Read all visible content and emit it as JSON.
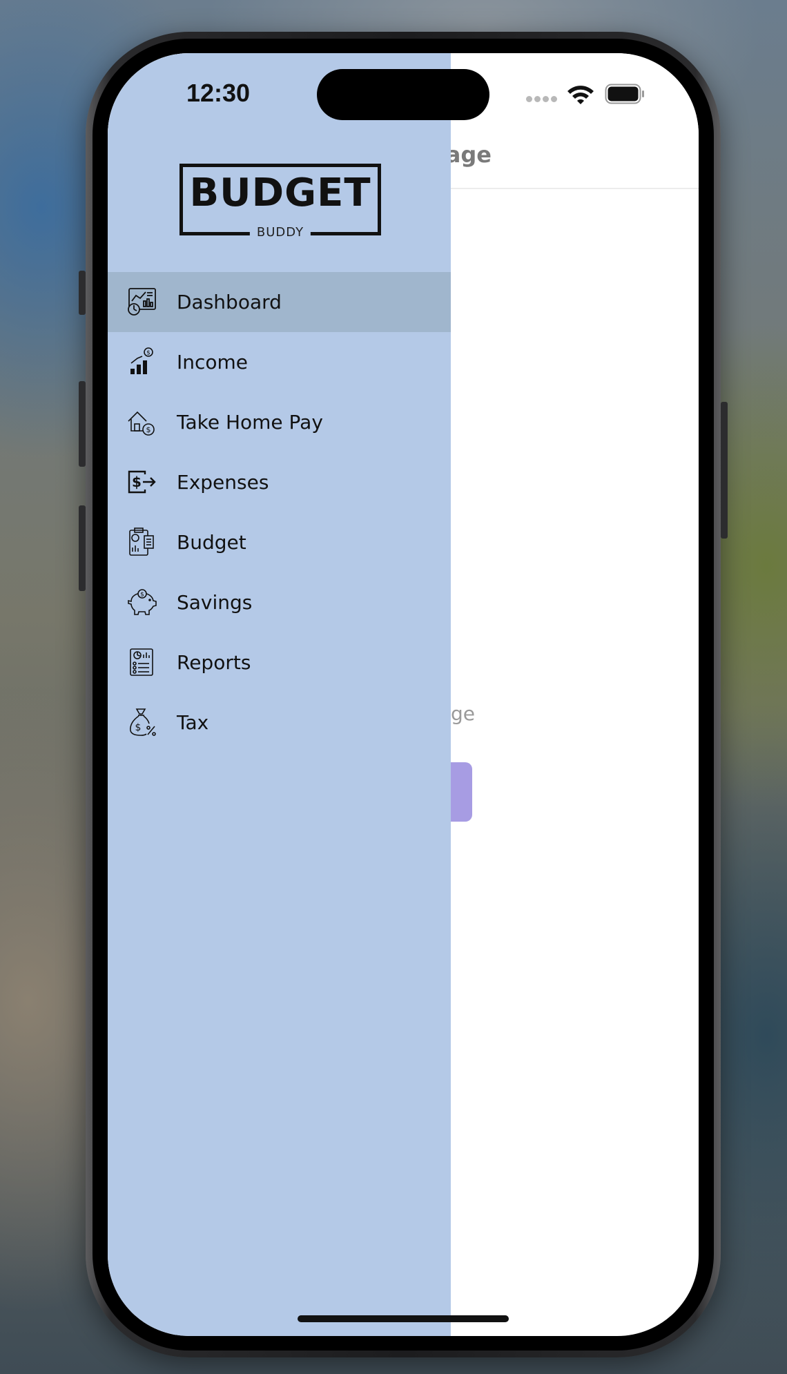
{
  "status_bar": {
    "time": "12:30"
  },
  "main": {
    "header_title_partial": "age",
    "caption_partial": "age"
  },
  "drawer": {
    "logo": {
      "word": "BUDGET",
      "sub": "BUDDY"
    },
    "menu": [
      {
        "label": "Dashboard",
        "icon": "dashboard-icon",
        "active": true
      },
      {
        "label": "Income",
        "icon": "income-chart-icon",
        "active": false
      },
      {
        "label": "Take Home Pay",
        "icon": "house-dollar-icon",
        "active": false
      },
      {
        "label": "Expenses",
        "icon": "expense-arrow-icon",
        "active": false
      },
      {
        "label": "Budget",
        "icon": "budget-clipboard-icon",
        "active": false
      },
      {
        "label": "Savings",
        "icon": "piggy-bank-icon",
        "active": false
      },
      {
        "label": "Reports",
        "icon": "report-document-icon",
        "active": false
      },
      {
        "label": "Tax",
        "icon": "money-bag-percent-icon",
        "active": false
      }
    ]
  },
  "colors": {
    "drawer_bg": "#b4c9e7",
    "active_item_bg": "#a0b6cd",
    "accent_button": "#a79ce3",
    "text": "#111111"
  }
}
